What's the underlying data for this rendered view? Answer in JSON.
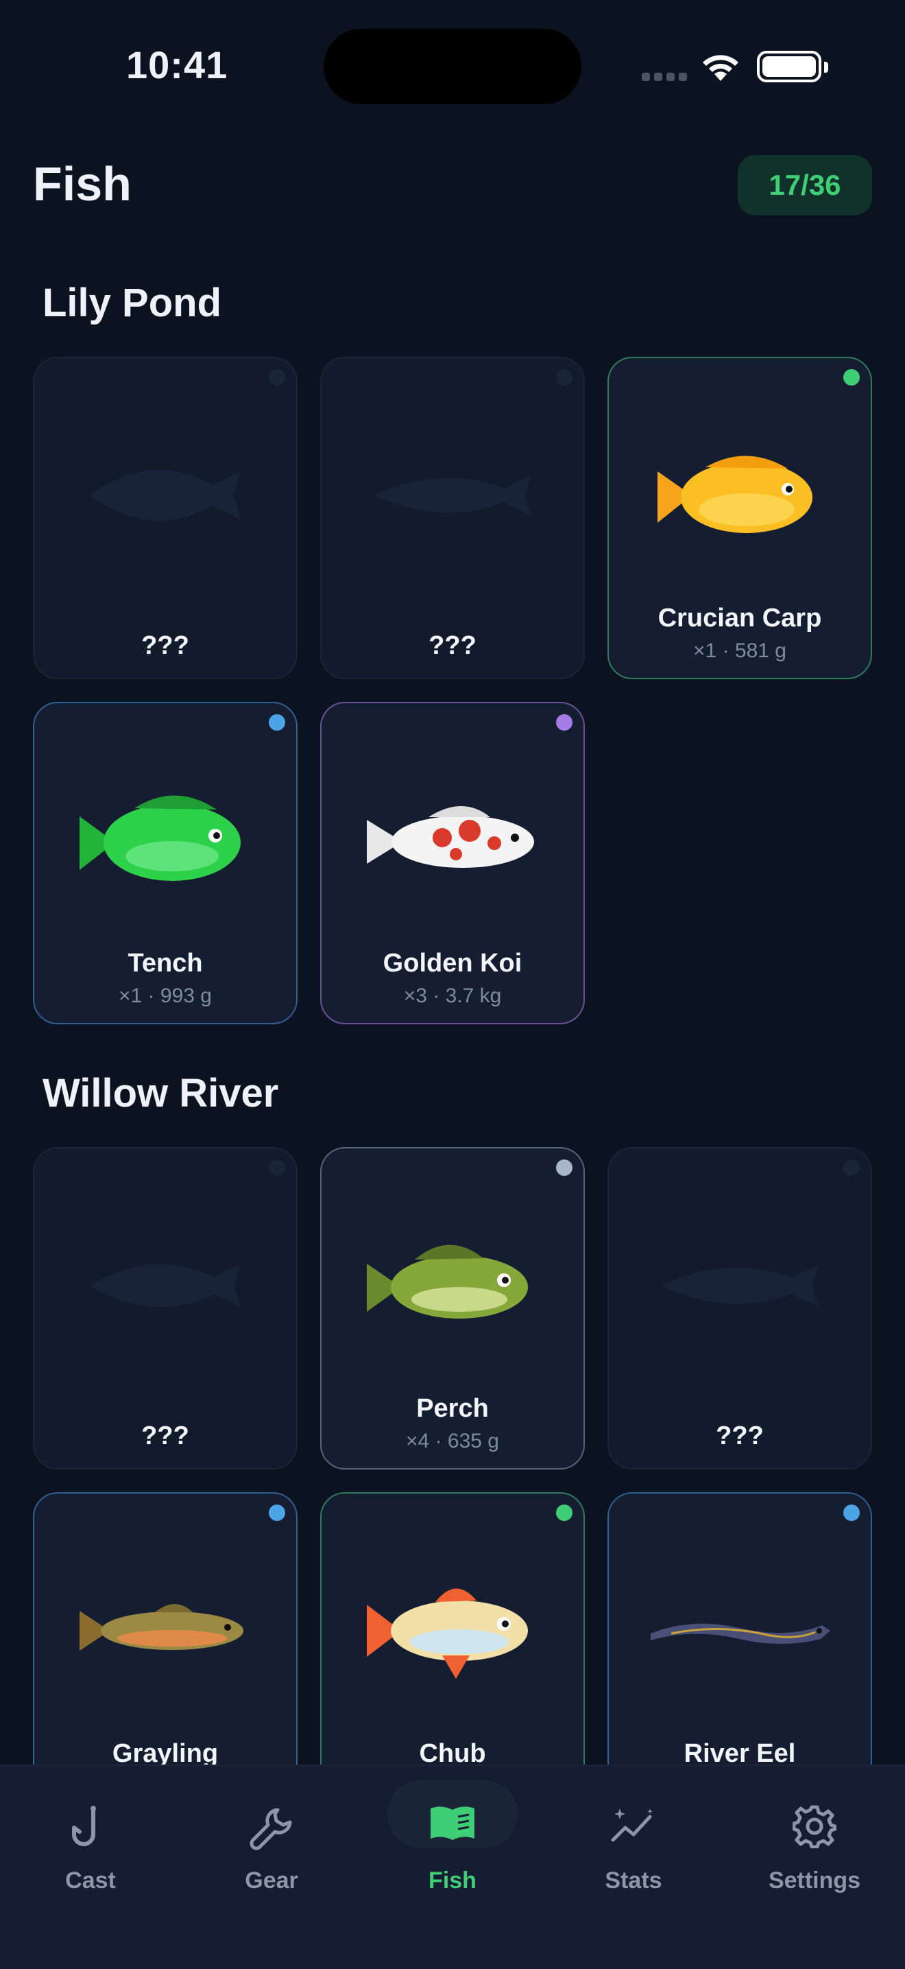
{
  "status_bar": {
    "time": "10:41"
  },
  "header": {
    "title": "Fish",
    "count": "17/36"
  },
  "sections": [
    {
      "title": "Lily Pond"
    },
    {
      "title": "Willow River"
    }
  ],
  "cards": [
    {
      "name": "???",
      "meta": "",
      "locked": true,
      "icon": "fish-silhouette-icon"
    },
    {
      "name": "???",
      "meta": "",
      "locked": true,
      "icon": "fish-silhouette-icon"
    },
    {
      "name": "Crucian Carp",
      "meta": "×1 · 581 g",
      "locked": false,
      "rarity_color": "#3fce75",
      "icon": "crucian-carp-icon"
    },
    {
      "name": "Tench",
      "meta": "×1 · 993 g",
      "locked": false,
      "rarity_color": "#4ca3e6",
      "icon": "tench-icon"
    },
    {
      "name": "Golden Koi",
      "meta": "×3 · 3.7 kg",
      "locked": false,
      "rarity_color": "#a67be8",
      "icon": "koi-icon"
    },
    {
      "name": "???",
      "meta": "",
      "locked": true,
      "icon": "fish-silhouette-icon"
    },
    {
      "name": "Perch",
      "meta": "×4 · 635 g",
      "locked": false,
      "rarity_color": "#a9b6ca",
      "icon": "perch-icon"
    },
    {
      "name": "???",
      "meta": "",
      "locked": true,
      "icon": "fish-silhouette-icon"
    },
    {
      "name": "Grayling",
      "meta": "",
      "locked": false,
      "rarity_color": "#4ca3e6",
      "icon": "grayling-icon"
    },
    {
      "name": "Chub",
      "meta": "",
      "locked": false,
      "rarity_color": "#3fce75",
      "icon": "chub-icon"
    },
    {
      "name": "River Eel",
      "meta": "",
      "locked": false,
      "rarity_color": "#4ca3e6",
      "icon": "eel-icon"
    }
  ],
  "tabs": [
    {
      "label": "Cast",
      "icon": "hook-icon"
    },
    {
      "label": "Gear",
      "icon": "wrench-icon"
    },
    {
      "label": "Fish",
      "icon": "book-icon",
      "active": true
    },
    {
      "label": "Stats",
      "icon": "sparkle-chart-icon"
    },
    {
      "label": "Settings",
      "icon": "gear-icon"
    }
  ],
  "colors": {
    "accent": "#3fce75",
    "background": "#0c1320"
  }
}
